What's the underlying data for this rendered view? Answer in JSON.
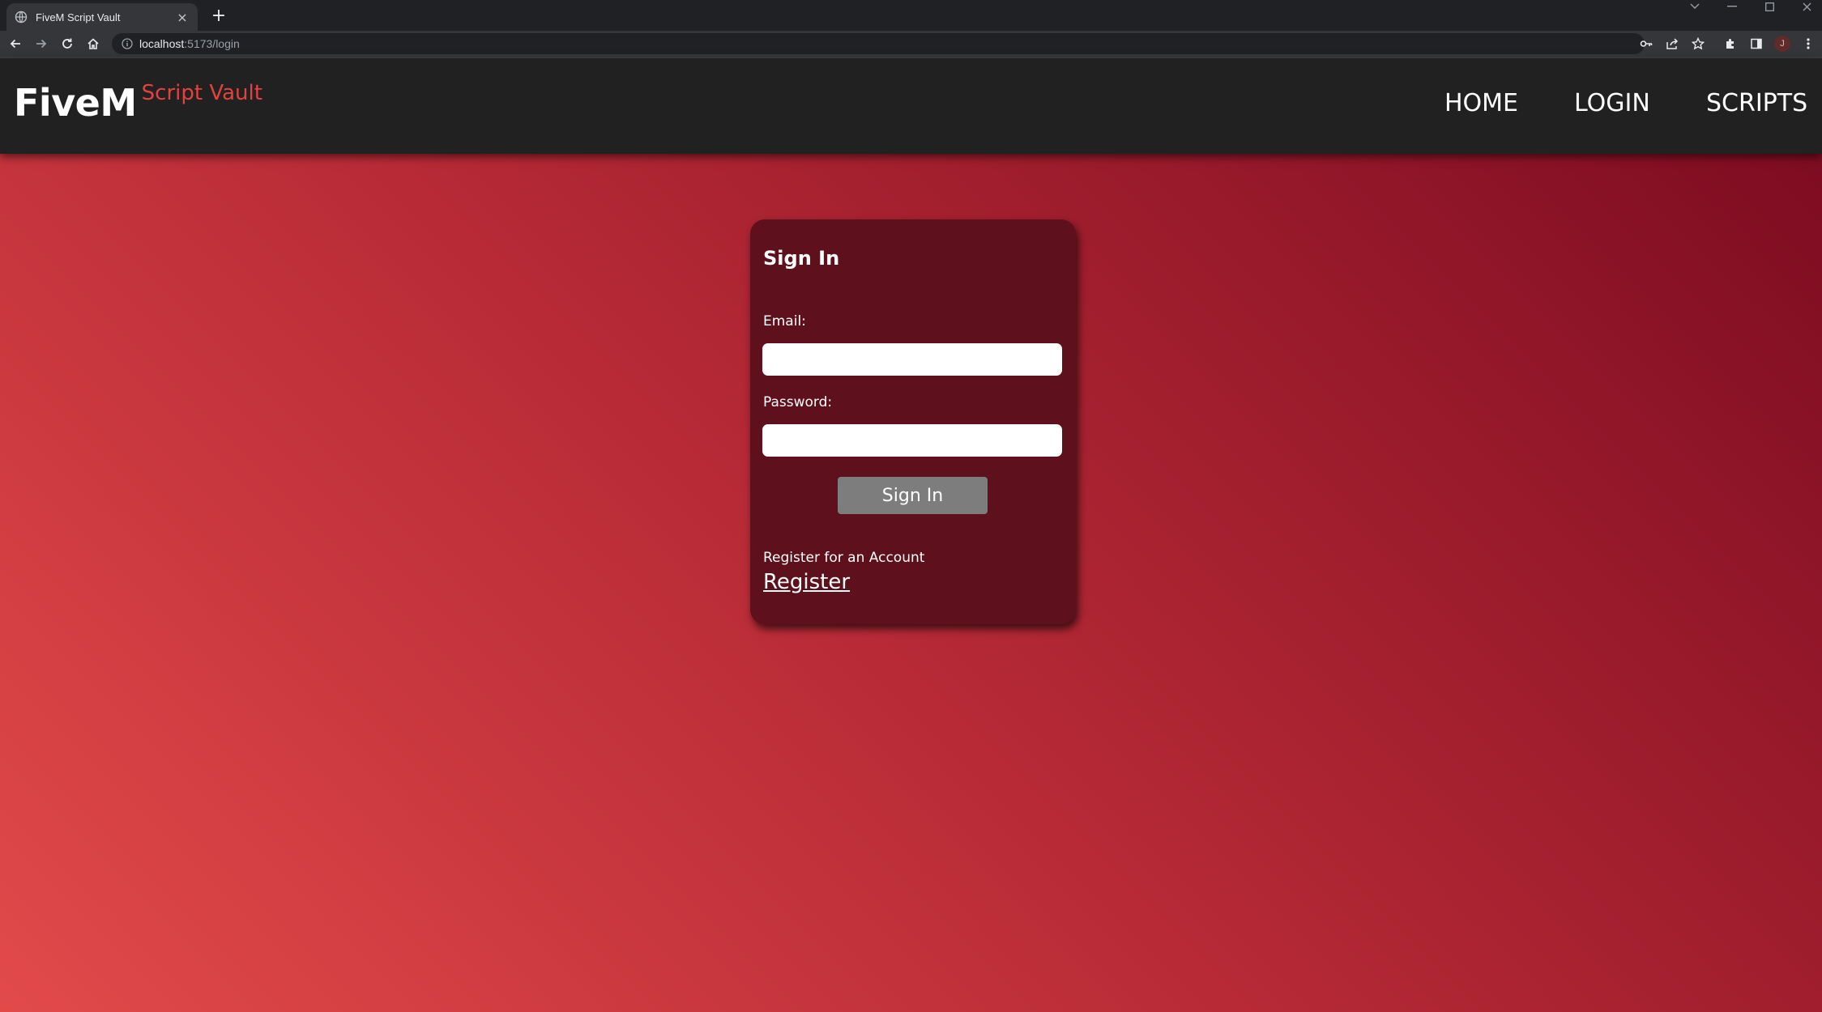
{
  "browser": {
    "tab_title": "FiveM Script Vault",
    "tab_close": "×",
    "new_tab": "+",
    "url_host": "localhost",
    "url_rest": ":5173/login",
    "profile_initial": "J"
  },
  "header": {
    "brand_main": "FiveM",
    "brand_sub": "Script Vault",
    "nav": [
      "HOME",
      "LOGIN",
      "SCRIPTS"
    ]
  },
  "login_card": {
    "title": "Sign In",
    "email_label": "Email:",
    "email_value": "",
    "password_label": "Password:",
    "password_value": "",
    "submit_label": "Sign In",
    "register_hint": "Register for an Account",
    "register_link": "Register"
  },
  "colors": {
    "header_bg": "#212121",
    "brand_accent": "#e4423f",
    "card_bg": "#5e101c",
    "button_bg": "#7d7d7d",
    "gradient_start": "#e24a4a",
    "gradient_end": "#7a0a20"
  }
}
